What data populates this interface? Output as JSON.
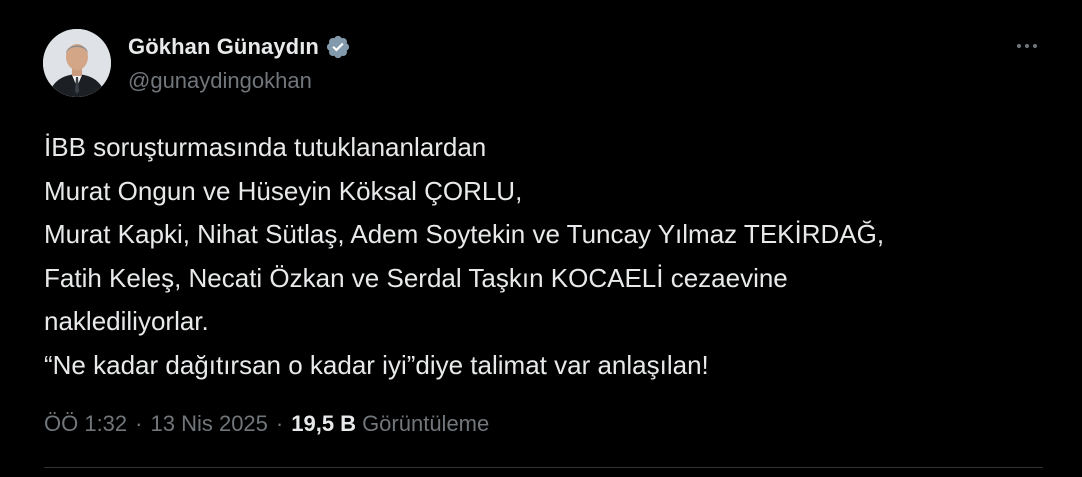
{
  "author": {
    "display_name": "Gökhan Günaydın",
    "handle": "@gunaydingokhan",
    "verified": true,
    "verified_color": "#829aab"
  },
  "tweet": {
    "lines": [
      "İBB soruşturmasında tutuklananlardan",
      "Murat Ongun ve Hüseyin Köksal ÇORLU,",
      "Murat Kapki, Nihat Sütlaş, Adem Soytekin ve Tuncay Yılmaz TEKİRDAĞ,",
      "Fatih Keleş, Necati Özkan ve Serdal Taşkın KOCAELİ cezaevine",
      "naklediliyorlar.",
      "“Ne kadar dağıtırsan o kadar iyi”diye talimat var anlaşılan!"
    ]
  },
  "meta": {
    "time": "ÖÖ 1:32",
    "separator": "·",
    "date": "13 Nis 2025",
    "views_count": "19,5 B",
    "views_label": "Görüntüleme"
  },
  "icons": {
    "verified": "verified-badge-icon",
    "more": "more-options-icon"
  },
  "colors": {
    "background": "#000000",
    "primary_text": "#e7e9ea",
    "secondary_text": "#71767b",
    "divider": "#2f3336"
  }
}
